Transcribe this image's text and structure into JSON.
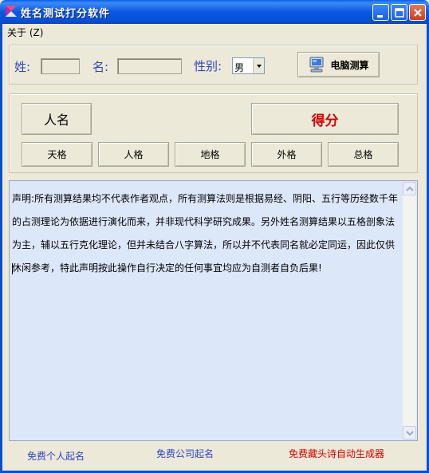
{
  "window": {
    "title": "姓名测试打分软件",
    "minimize": "minimize-icon",
    "maximize": "maximize-icon",
    "close": "close-icon"
  },
  "menu": {
    "about_label": "关于 (Z)"
  },
  "form": {
    "surname_label": "姓:",
    "surname_value": "",
    "given_name_label": "名:",
    "given_name_value": "",
    "gender_label": "性别:",
    "gender_value": "男",
    "test_button_label": "电脑测算",
    "test_button_icon": "computer-icon"
  },
  "results": {
    "name_label": "人名",
    "score_label": "得分",
    "grids": [
      "天格",
      "人格",
      "地格",
      "外格",
      "总格"
    ]
  },
  "disclaimer": {
    "text": "声明:所有测算结果均不代表作者观点，所有测算法则是根据易经、阴阳、五行等历经数千年的占测理论为依据进行演化而来，并非现代科学研究成果。另外姓名测算结果以五格剖象法为主，辅以五行克化理论，但并未结合八字算法，所以并不代表同名就必定同运，因此仅供休闲参考，特此声明按此操作自行决定的任何事宜均应为自测者自负后果!"
  },
  "links": {
    "personal": "免费个人起名",
    "company": "免费公司起名",
    "poem": "免费藏头诗自动生成器"
  },
  "colors": {
    "accent_blue": "#2b44c4",
    "score_red": "#d40000",
    "textarea_bg": "#dde7fa"
  }
}
